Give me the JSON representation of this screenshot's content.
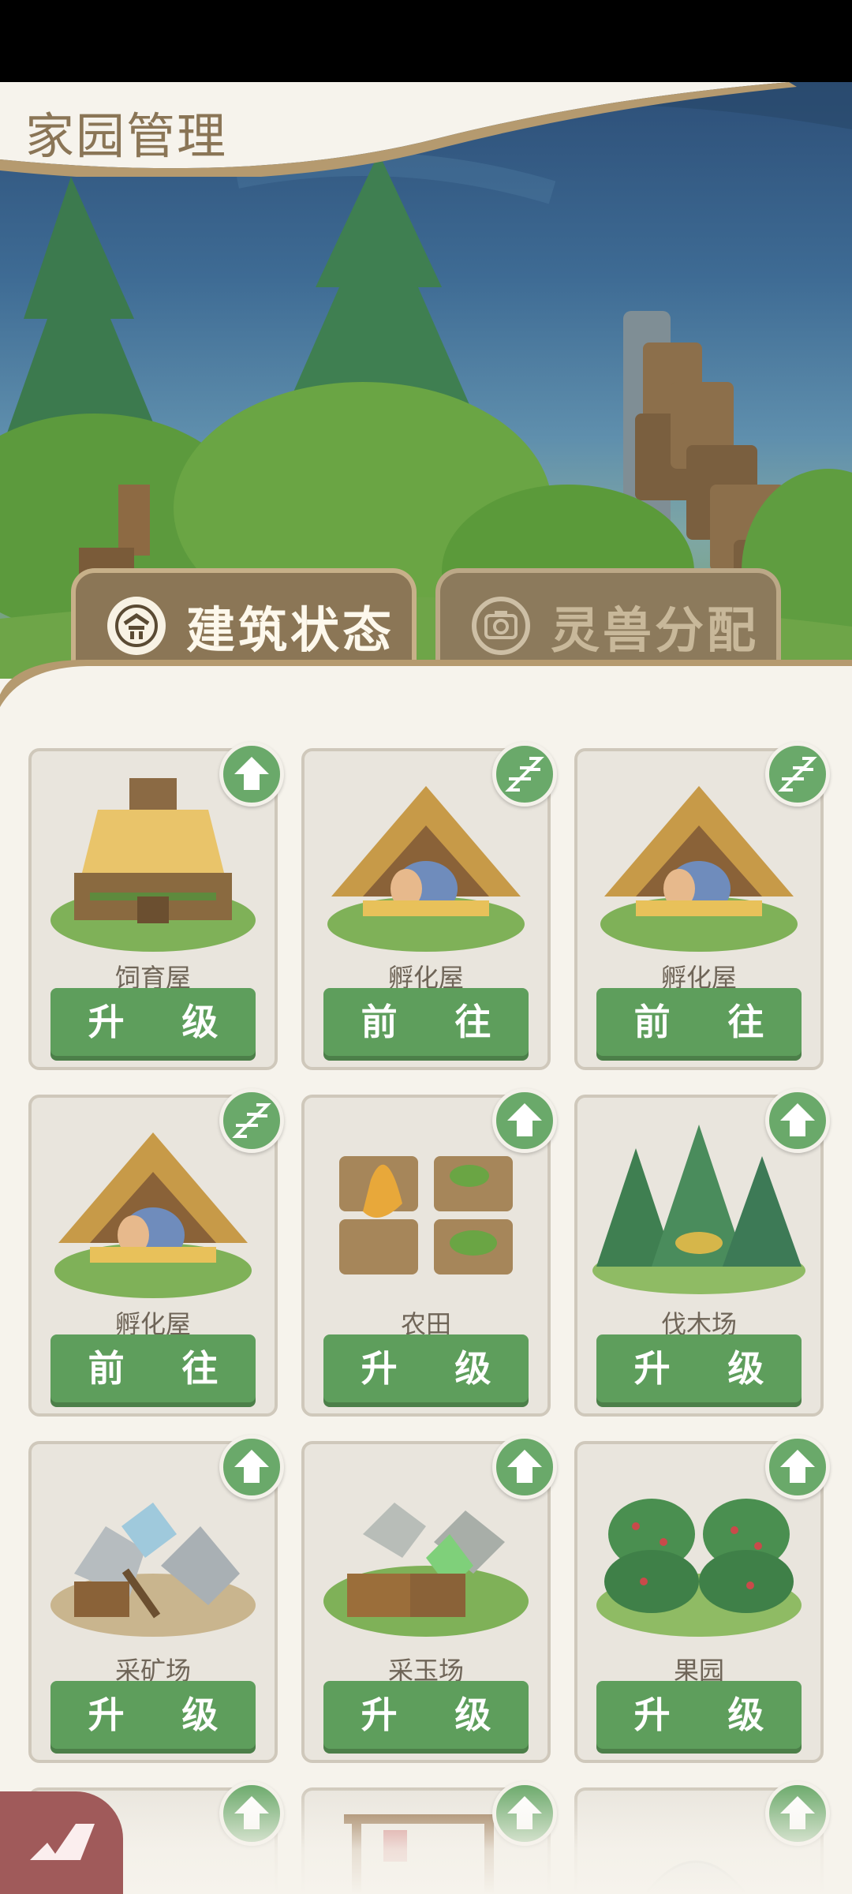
{
  "page": {
    "title": "家园管理"
  },
  "tabs": [
    {
      "id": "building",
      "label": "建筑状态",
      "icon": "house-icon",
      "active": true
    },
    {
      "id": "beast",
      "label": "灵兽分配",
      "icon": "camera-icon",
      "active": false
    }
  ],
  "buildings": [
    {
      "name": "饲育屋",
      "action": "升 级",
      "badge": "upgrade-arrow-icon",
      "art": "barn-art"
    },
    {
      "name": "孵化屋",
      "action": "前 往",
      "badge": "sleeping-zzz-icon",
      "art": "hut-art"
    },
    {
      "name": "孵化屋",
      "action": "前 往",
      "badge": "sleeping-zzz-icon",
      "art": "hut-art"
    },
    {
      "name": "孵化屋",
      "action": "前 往",
      "badge": "sleeping-zzz-icon",
      "art": "hut-art"
    },
    {
      "name": "农田",
      "action": "升 级",
      "badge": "upgrade-arrow-icon",
      "art": "farm-art"
    },
    {
      "name": "伐木场",
      "action": "升 级",
      "badge": "upgrade-arrow-icon",
      "art": "forest-art"
    },
    {
      "name": "采矿场",
      "action": "升 级",
      "badge": "upgrade-arrow-icon",
      "art": "mine-art"
    },
    {
      "name": "采玉场",
      "action": "升 级",
      "badge": "upgrade-arrow-icon",
      "art": "jade-art"
    },
    {
      "name": "果园",
      "action": "升 级",
      "badge": "upgrade-arrow-icon",
      "art": "orchard-art"
    }
  ],
  "colors": {
    "accent_green": "#5e9e5c",
    "tab_brown": "#8b7656",
    "title_brown": "#8a7556"
  }
}
